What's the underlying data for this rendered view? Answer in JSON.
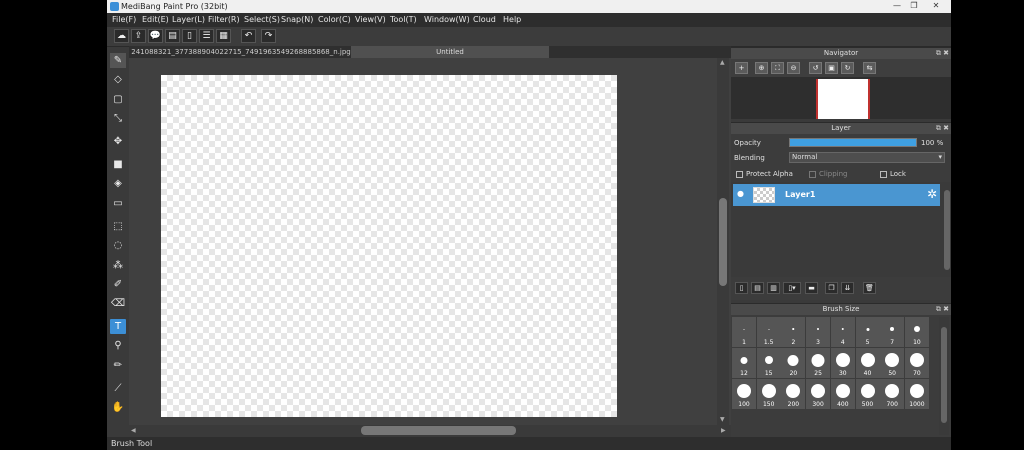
{
  "window": {
    "title": "MediBang Paint Pro (32bit)",
    "min": "—",
    "restore": "❐",
    "close": "✕"
  },
  "menu": [
    "File(F)",
    "Edit(E)",
    "Layer(L)",
    "Filter(R)",
    "Select(S)",
    "Snap(N)",
    "Color(C)",
    "View(V)",
    "Tool(T)",
    "Window(W)",
    "Cloud",
    "Help"
  ],
  "tabs": {
    "file": "241088321_377388904022715_7491963549268885868_n.jpg",
    "untitled": "Untitled"
  },
  "status": "Brush Tool",
  "navigator": {
    "title": "Navigator"
  },
  "layer": {
    "title": "Layer",
    "opacity_label": "Opacity",
    "opacity_value": "100 %",
    "opacity_fraction": 1.0,
    "blending_label": "Blending",
    "blending_value": "Normal",
    "protect_alpha": "Protect Alpha",
    "clipping": "Clipping",
    "lock": "Lock",
    "layer_name": "Layer1"
  },
  "brush_size": {
    "title": "Brush Size",
    "sizes": [
      "1",
      "1.5",
      "2",
      "3",
      "4",
      "5",
      "7",
      "10",
      "12",
      "15",
      "20",
      "25",
      "30",
      "40",
      "50",
      "70",
      "100",
      "150",
      "200",
      "300",
      "400",
      "500",
      "700",
      "1000"
    ]
  },
  "colors": {
    "accent": "#3c8fd6",
    "layer_selected": "#4a96d1"
  }
}
